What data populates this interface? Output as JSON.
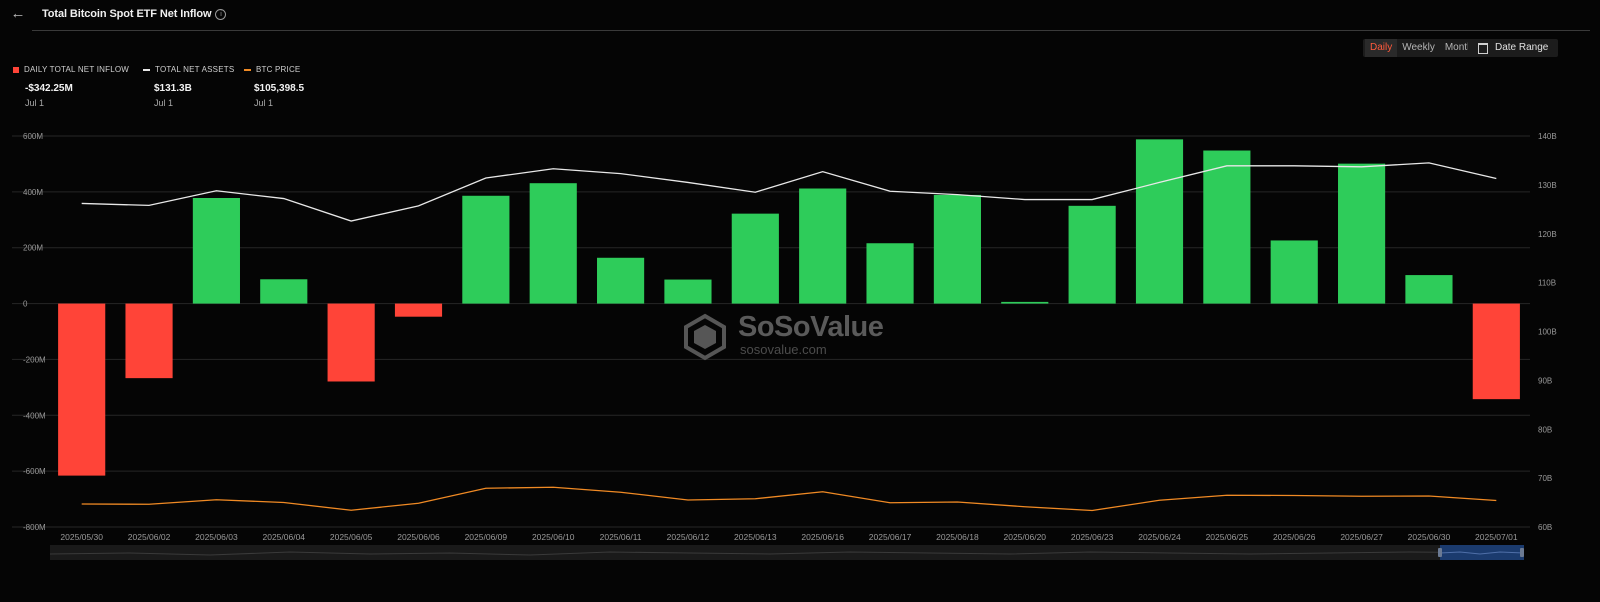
{
  "header": {
    "title": "Total Bitcoin Spot ETF Net Inflow"
  },
  "controls": {
    "tabs": [
      "Daily",
      "Weekly",
      "Monthly"
    ],
    "active_tab": "Daily",
    "date_range_label": "Date Range"
  },
  "legend": [
    {
      "label": "DAILY TOTAL NET INFLOW",
      "value": "-$342.25M",
      "date": "Jul 1",
      "color": "#2ecc5a"
    },
    {
      "label": "TOTAL NET ASSETS",
      "value": "$131.3B",
      "date": "Jul 1",
      "color": "#e8e8e8"
    },
    {
      "label": "BTC PRICE",
      "value": "$105,398.5",
      "date": "Jul 1",
      "color": "#f08a24"
    }
  ],
  "watermark": {
    "name": "SoSoValue",
    "url": "sosovalue.com"
  },
  "colors": {
    "positive": "#2ecc5a",
    "negative": "#ff4438",
    "assets_line": "#e8e8e8",
    "price_line": "#f08a24",
    "grid": "#262626",
    "axis_text": "#9a9a9a"
  },
  "chart_data": {
    "type": "bar",
    "categories": [
      "2025/05/30",
      "2025/06/02",
      "2025/06/03",
      "2025/06/04",
      "2025/06/05",
      "2025/06/06",
      "2025/06/09",
      "2025/06/10",
      "2025/06/11",
      "2025/06/12",
      "2025/06/13",
      "2025/06/16",
      "2025/06/17",
      "2025/06/18",
      "2025/06/20",
      "2025/06/23",
      "2025/06/24",
      "2025/06/25",
      "2025/06/26",
      "2025/06/27",
      "2025/06/30",
      "2025/07/01"
    ],
    "series": [
      {
        "name": "DAILY TOTAL NET INFLOW",
        "type": "bar",
        "axis": "left",
        "unit": "M",
        "values": [
          -616,
          -267,
          378,
          87,
          -279,
          -47,
          386,
          431,
          164,
          86,
          322,
          412,
          216,
          389,
          6,
          350,
          588,
          548,
          226,
          501,
          102,
          -342.25
        ]
      },
      {
        "name": "TOTAL NET ASSETS",
        "type": "line",
        "axis": "right",
        "unit": "B",
        "values": [
          126.2,
          125.8,
          128.8,
          127.2,
          122.6,
          125.7,
          131.4,
          133.3,
          132.3,
          130.5,
          128.5,
          132.7,
          128.7,
          128.0,
          127.0,
          127.0,
          130.5,
          133.9,
          133.9,
          133.7,
          134.5,
          131.3
        ]
      },
      {
        "name": "BTC PRICE",
        "type": "line",
        "axis": "hidden",
        "values": [
          104000,
          103900,
          105700,
          104600,
          101500,
          104300,
          110300,
          110700,
          108700,
          105600,
          106100,
          108900,
          104500,
          104800,
          102900,
          101400,
          105500,
          107500,
          107400,
          107100,
          107200,
          105398.5
        ]
      }
    ],
    "y_left": {
      "ticks": [
        "600M",
        "400M",
        "200M",
        "0",
        "-200M",
        "-400M",
        "-600M",
        "-800M"
      ],
      "range": [
        -800,
        600
      ]
    },
    "y_right": {
      "ticks": [
        "140B",
        "130B",
        "120B",
        "110B",
        "100B",
        "90B",
        "80B",
        "70B",
        "60B"
      ],
      "range": [
        60,
        140
      ]
    },
    "grid": true
  }
}
